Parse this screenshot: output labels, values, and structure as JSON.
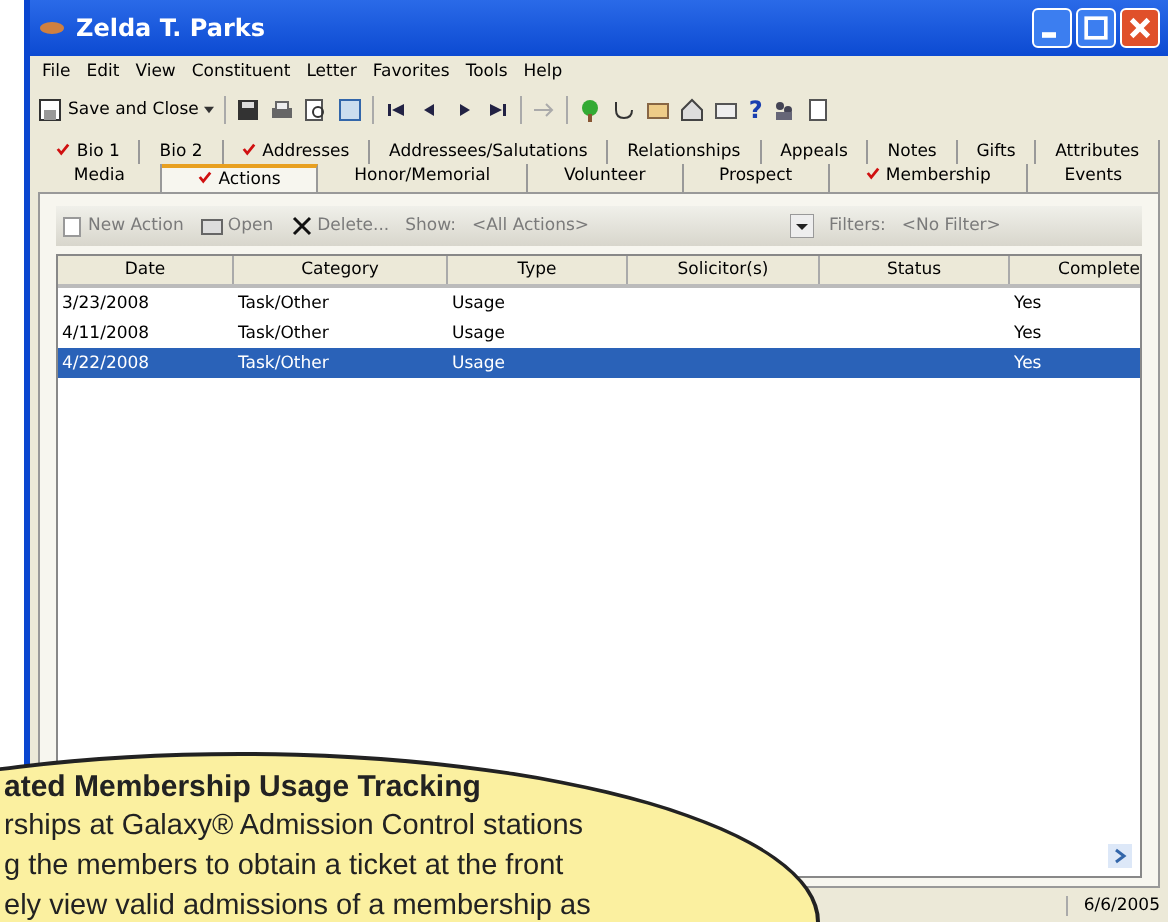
{
  "window": {
    "title": "Zelda T. Parks"
  },
  "menu": [
    "File",
    "Edit",
    "View",
    "Constituent",
    "Letter",
    "Favorites",
    "Tools",
    "Help"
  ],
  "toolbar": {
    "save_label": "Save and Close",
    "help_glyph": "?"
  },
  "tab_rows": [
    [
      {
        "label": "Bio 1",
        "checked": true,
        "selected": false
      },
      {
        "label": "Bio 2",
        "checked": false,
        "selected": false
      },
      {
        "label": "Addresses",
        "checked": true,
        "selected": false
      },
      {
        "label": "Addressees/Salutations",
        "checked": false,
        "selected": false
      },
      {
        "label": "Relationships",
        "checked": false,
        "selected": false
      },
      {
        "label": "Appeals",
        "checked": false,
        "selected": false
      },
      {
        "label": "Notes",
        "checked": false,
        "selected": false
      },
      {
        "label": "Gifts",
        "checked": false,
        "selected": false
      },
      {
        "label": "Attributes",
        "checked": false,
        "selected": false
      }
    ],
    [
      {
        "label": "Media",
        "checked": false,
        "selected": false
      },
      {
        "label": "Actions",
        "checked": true,
        "selected": true
      },
      {
        "label": "Honor/Memorial",
        "checked": false,
        "selected": false
      },
      {
        "label": "Volunteer",
        "checked": false,
        "selected": false
      },
      {
        "label": "Prospect",
        "checked": false,
        "selected": false
      },
      {
        "label": "Membership",
        "checked": true,
        "selected": false
      },
      {
        "label": "Events",
        "checked": false,
        "selected": false
      }
    ]
  ],
  "action_bar": {
    "new_action": {
      "label": "New Action",
      "disabled": true
    },
    "open": {
      "label": "Open",
      "disabled": true
    },
    "delete": {
      "label": "Delete...",
      "disabled": true
    },
    "show_label": "Show:",
    "show_value": "<All Actions>",
    "filters_label": "Filters:",
    "filters_value": "<No Filter>"
  },
  "table": {
    "columns": [
      "Date",
      "Category",
      "Type",
      "Solicitor(s)",
      "Status",
      "Complete"
    ],
    "rows": [
      {
        "cells": [
          "3/23/2008",
          "Task/Other",
          "Usage",
          "",
          "",
          "Yes"
        ],
        "selected": false
      },
      {
        "cells": [
          "4/11/2008",
          "Task/Other",
          "Usage",
          "",
          "",
          "Yes"
        ],
        "selected": false
      },
      {
        "cells": [
          "4/22/2008",
          "Task/Other",
          "Usage",
          "",
          "",
          "Yes"
        ],
        "selected": true
      }
    ]
  },
  "status_bar": {
    "date": "6/6/2005"
  },
  "callout": {
    "title": "ated Membership Usage Tracking",
    "lines": [
      "rships at Galaxy® Admission Control stations",
      "g the members to obtain a ticket at the front",
      "ely view valid admissions of a membership as"
    ]
  }
}
